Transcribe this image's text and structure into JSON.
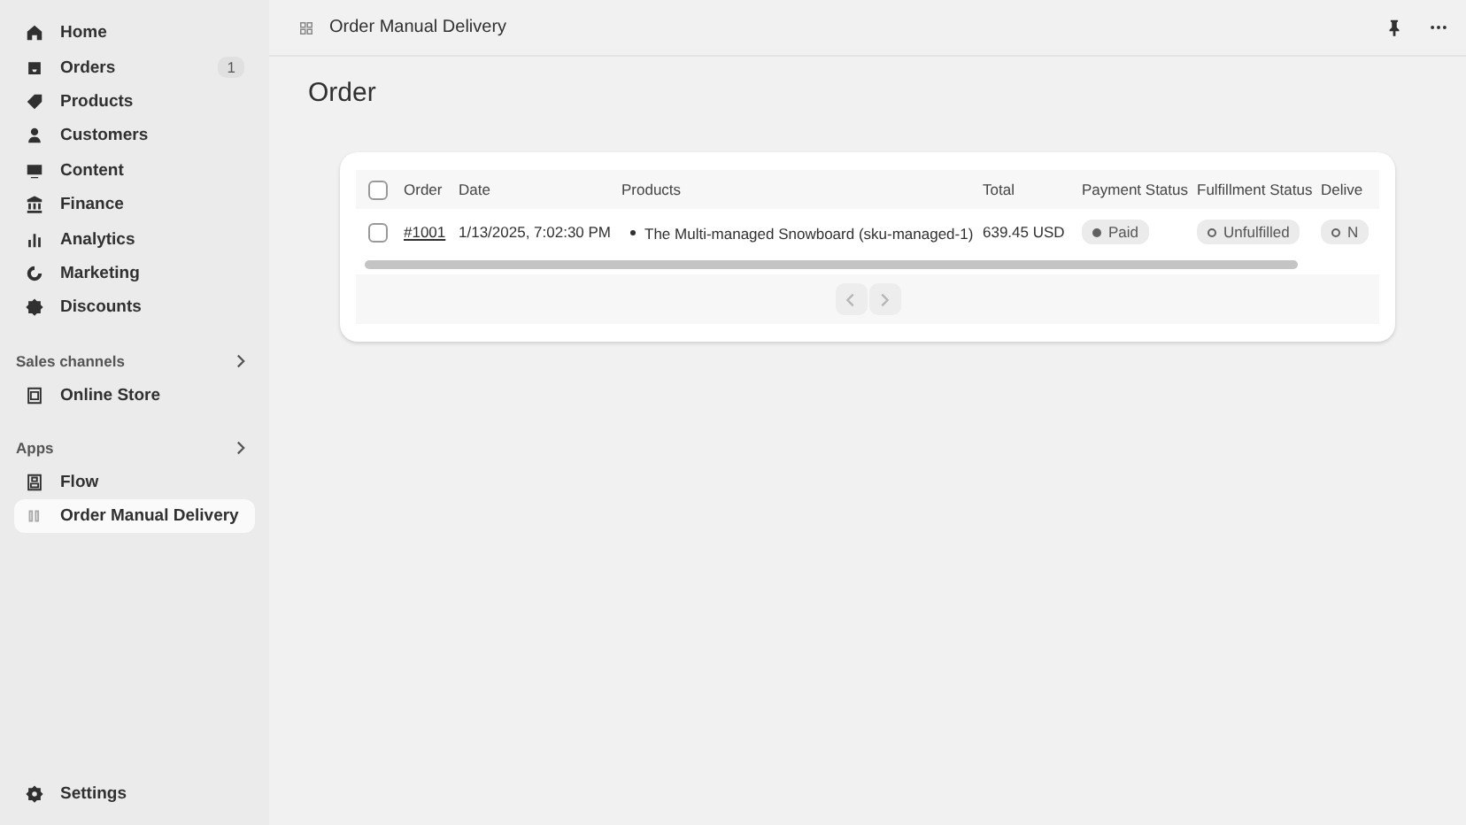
{
  "sidebar": {
    "items": [
      {
        "label": "Home",
        "selected": false
      },
      {
        "label": "Orders",
        "selected": false,
        "badge": "1"
      },
      {
        "label": "Products",
        "selected": false
      },
      {
        "label": "Customers",
        "selected": false
      },
      {
        "label": "Content",
        "selected": false
      },
      {
        "label": "Finance",
        "selected": false
      },
      {
        "label": "Analytics",
        "selected": false
      },
      {
        "label": "Marketing",
        "selected": false
      },
      {
        "label": "Discounts",
        "selected": false
      }
    ],
    "sections": [
      {
        "title": "Sales channels",
        "items": [
          {
            "label": "Online Store",
            "selected": false
          }
        ]
      },
      {
        "title": "Apps",
        "items": [
          {
            "label": "Flow",
            "selected": false
          },
          {
            "label": "Order Manual Delivery",
            "selected": true
          }
        ]
      }
    ],
    "footer": {
      "label": "Settings"
    }
  },
  "topbar": {
    "title": "Order Manual Delivery"
  },
  "page": {
    "title": "Order"
  },
  "table": {
    "select_all": {
      "checked": false
    },
    "columns": [
      "Order",
      "Date",
      "Products",
      "Total",
      "Payment Status",
      "Fulfillment Status",
      "Delive"
    ],
    "rows": [
      {
        "checked": false,
        "order": "#1001",
        "date": "1/13/2025, 7:02:30 PM",
        "products": [
          "The Multi-managed Snowboard (sku-managed-1)"
        ],
        "total": "639.45 USD",
        "badges": [
          {
            "label": "Paid",
            "complete": true
          },
          {
            "label": "Unfulfilled",
            "complete": false
          },
          {
            "label": "N",
            "complete": false
          }
        ]
      }
    ],
    "pagination": {
      "previous": {
        "disabled": true
      },
      "next": {
        "disabled": true
      }
    }
  }
}
